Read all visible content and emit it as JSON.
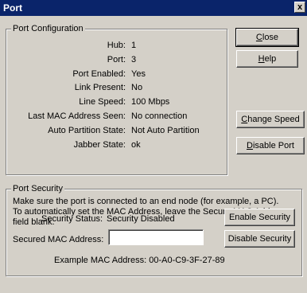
{
  "window": {
    "title": "Port",
    "close_glyph": "x"
  },
  "config": {
    "legend": "Port Configuration",
    "rows": [
      {
        "label": "Hub:",
        "value": "1"
      },
      {
        "label": "Port:",
        "value": "3"
      },
      {
        "label": "Port Enabled:",
        "value": "Yes"
      },
      {
        "label": "Link Present:",
        "value": "No"
      },
      {
        "label": "Line Speed:",
        "value": "100 Mbps"
      },
      {
        "label": "Last MAC Address Seen:",
        "value": "No connection"
      },
      {
        "label": "Auto Partition State:",
        "value": "Not Auto Partition"
      },
      {
        "label": "Jabber State:",
        "value": "ok"
      }
    ]
  },
  "buttons": {
    "close": {
      "pre": "",
      "key": "C",
      "post": "lose"
    },
    "help": {
      "pre": "",
      "key": "H",
      "post": "elp"
    },
    "change_speed": {
      "pre": "",
      "key": "C",
      "post": "hange Speed"
    },
    "disable_port": {
      "pre": "",
      "key": "D",
      "post": "isable Port"
    },
    "enable_security": "Enable Security",
    "disable_security": "Disable Security"
  },
  "security": {
    "legend": "Port Security",
    "description_1": "Make sure the port is connected to an end node (for example, a PC).",
    "description_2": "To automatically set the MAC Address, leave the Secure MAC Address",
    "description_3": "field blank.",
    "status_label": "Security Status:",
    "status_value": "Security Disabled",
    "mac_label": "Secured MAC Address:",
    "mac_value": "",
    "example": "Example MAC Address: 00-A0-C9-3F-27-89"
  }
}
